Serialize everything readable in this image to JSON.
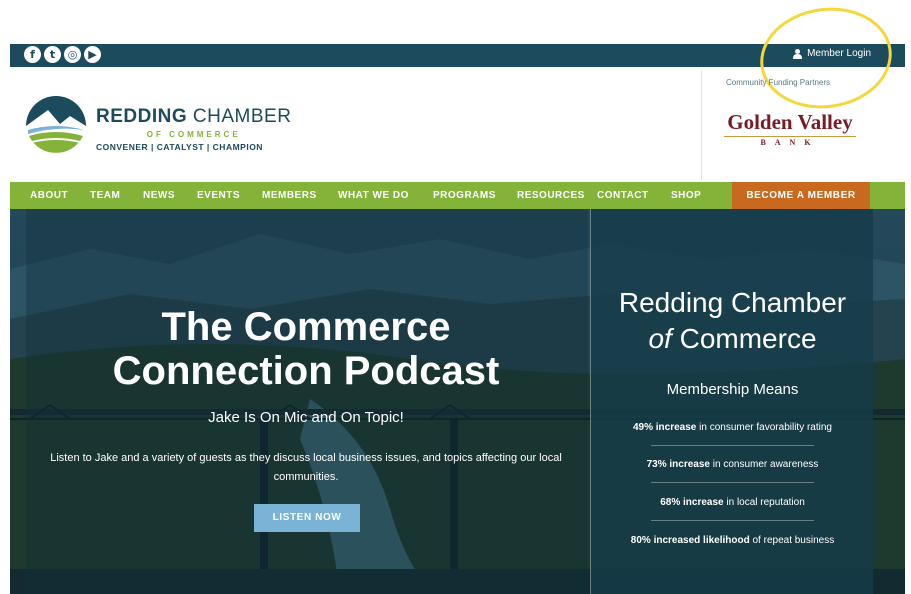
{
  "topbar": {
    "social": [
      {
        "icon": "facebook-icon",
        "glyph": "f"
      },
      {
        "icon": "twitter-icon",
        "glyph": "t"
      },
      {
        "icon": "instagram-icon",
        "glyph": "◎"
      },
      {
        "icon": "youtube-icon",
        "glyph": "▶"
      }
    ],
    "login_label": "Member Login"
  },
  "header": {
    "logo_bold": "REDDING",
    "logo_light": " CHAMBER",
    "logo_sub": "OF COMMERCE",
    "logo_tagline": "CONVENER | CATALYST | CHAMPION",
    "sponsor_label": "Community Funding Partners",
    "sponsor_name": "Golden Valley",
    "sponsor_sub": "BANK"
  },
  "nav": {
    "items": [
      "ABOUT",
      "TEAM",
      "NEWS",
      "EVENTS",
      "MEMBERS",
      "WHAT WE DO",
      "PROGRAMS",
      "RESOURCES",
      "CONTACT",
      "SHOP"
    ],
    "cta": "BECOME A MEMBER"
  },
  "hero": {
    "title_line1": "The Commerce",
    "title_line2": "Connection Podcast",
    "subtitle": "Jake Is On Mic and On Topic!",
    "description": "Listen to Jake and a variety of guests as they discuss local business issues, and topics affecting our local communities.",
    "button": "LISTEN NOW"
  },
  "panel": {
    "title_line1": "Redding Chamber",
    "title_of": "of",
    "title_line2_rest": " Commerce",
    "heading": "Membership Means",
    "stats": [
      {
        "bold": "49% increase",
        "rest": " in consumer favorability rating"
      },
      {
        "bold": "73% increase",
        "rest": " in consumer awareness"
      },
      {
        "bold": "68% increase",
        "rest": " in local reputation"
      },
      {
        "bold": "80% increased likelihood",
        "rest": " of repeat business"
      }
    ]
  },
  "colors": {
    "topbar": "#1d4b5e",
    "nav_green": "#84b339",
    "cta_orange": "#c8691f",
    "button_blue": "#7ab3d6",
    "annotation_yellow": "#f5d63b"
  }
}
